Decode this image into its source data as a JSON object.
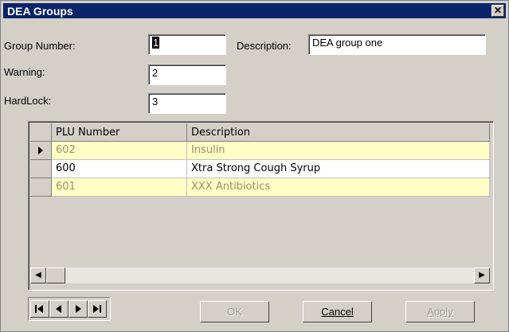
{
  "window": {
    "title": "DEA Groups",
    "close_glyph": "✕"
  },
  "form": {
    "group_number_label": "Group Number:",
    "group_number_value": "1",
    "description_label": "Description:",
    "description_value": "DEA group one",
    "warning_label": "Warning:",
    "warning_value": "2",
    "hardlock_label": "HardLock:",
    "hardlock_value": "3"
  },
  "grid": {
    "columns": [
      "PLU Number",
      "Description"
    ],
    "rows": [
      {
        "plu": "602",
        "description": "Insulin",
        "current": true
      },
      {
        "plu": "600",
        "description": "Xtra Strong Cough Syrup",
        "current": false
      },
      {
        "plu": "601",
        "description": "XXX Antibiotics",
        "current": false
      }
    ],
    "current_row_icon": "row-pointer-icon"
  },
  "nav": {
    "first": "first-record-icon",
    "prev": "prev-record-icon",
    "next": "next-record-icon",
    "last": "last-record-icon"
  },
  "buttons": {
    "ok": "OK",
    "cancel": "Cancel",
    "apply": "Apply"
  },
  "colors": {
    "titlebar": "#0a246a",
    "window": "#d4d0c8",
    "row_highlight": "#ffffc6"
  }
}
